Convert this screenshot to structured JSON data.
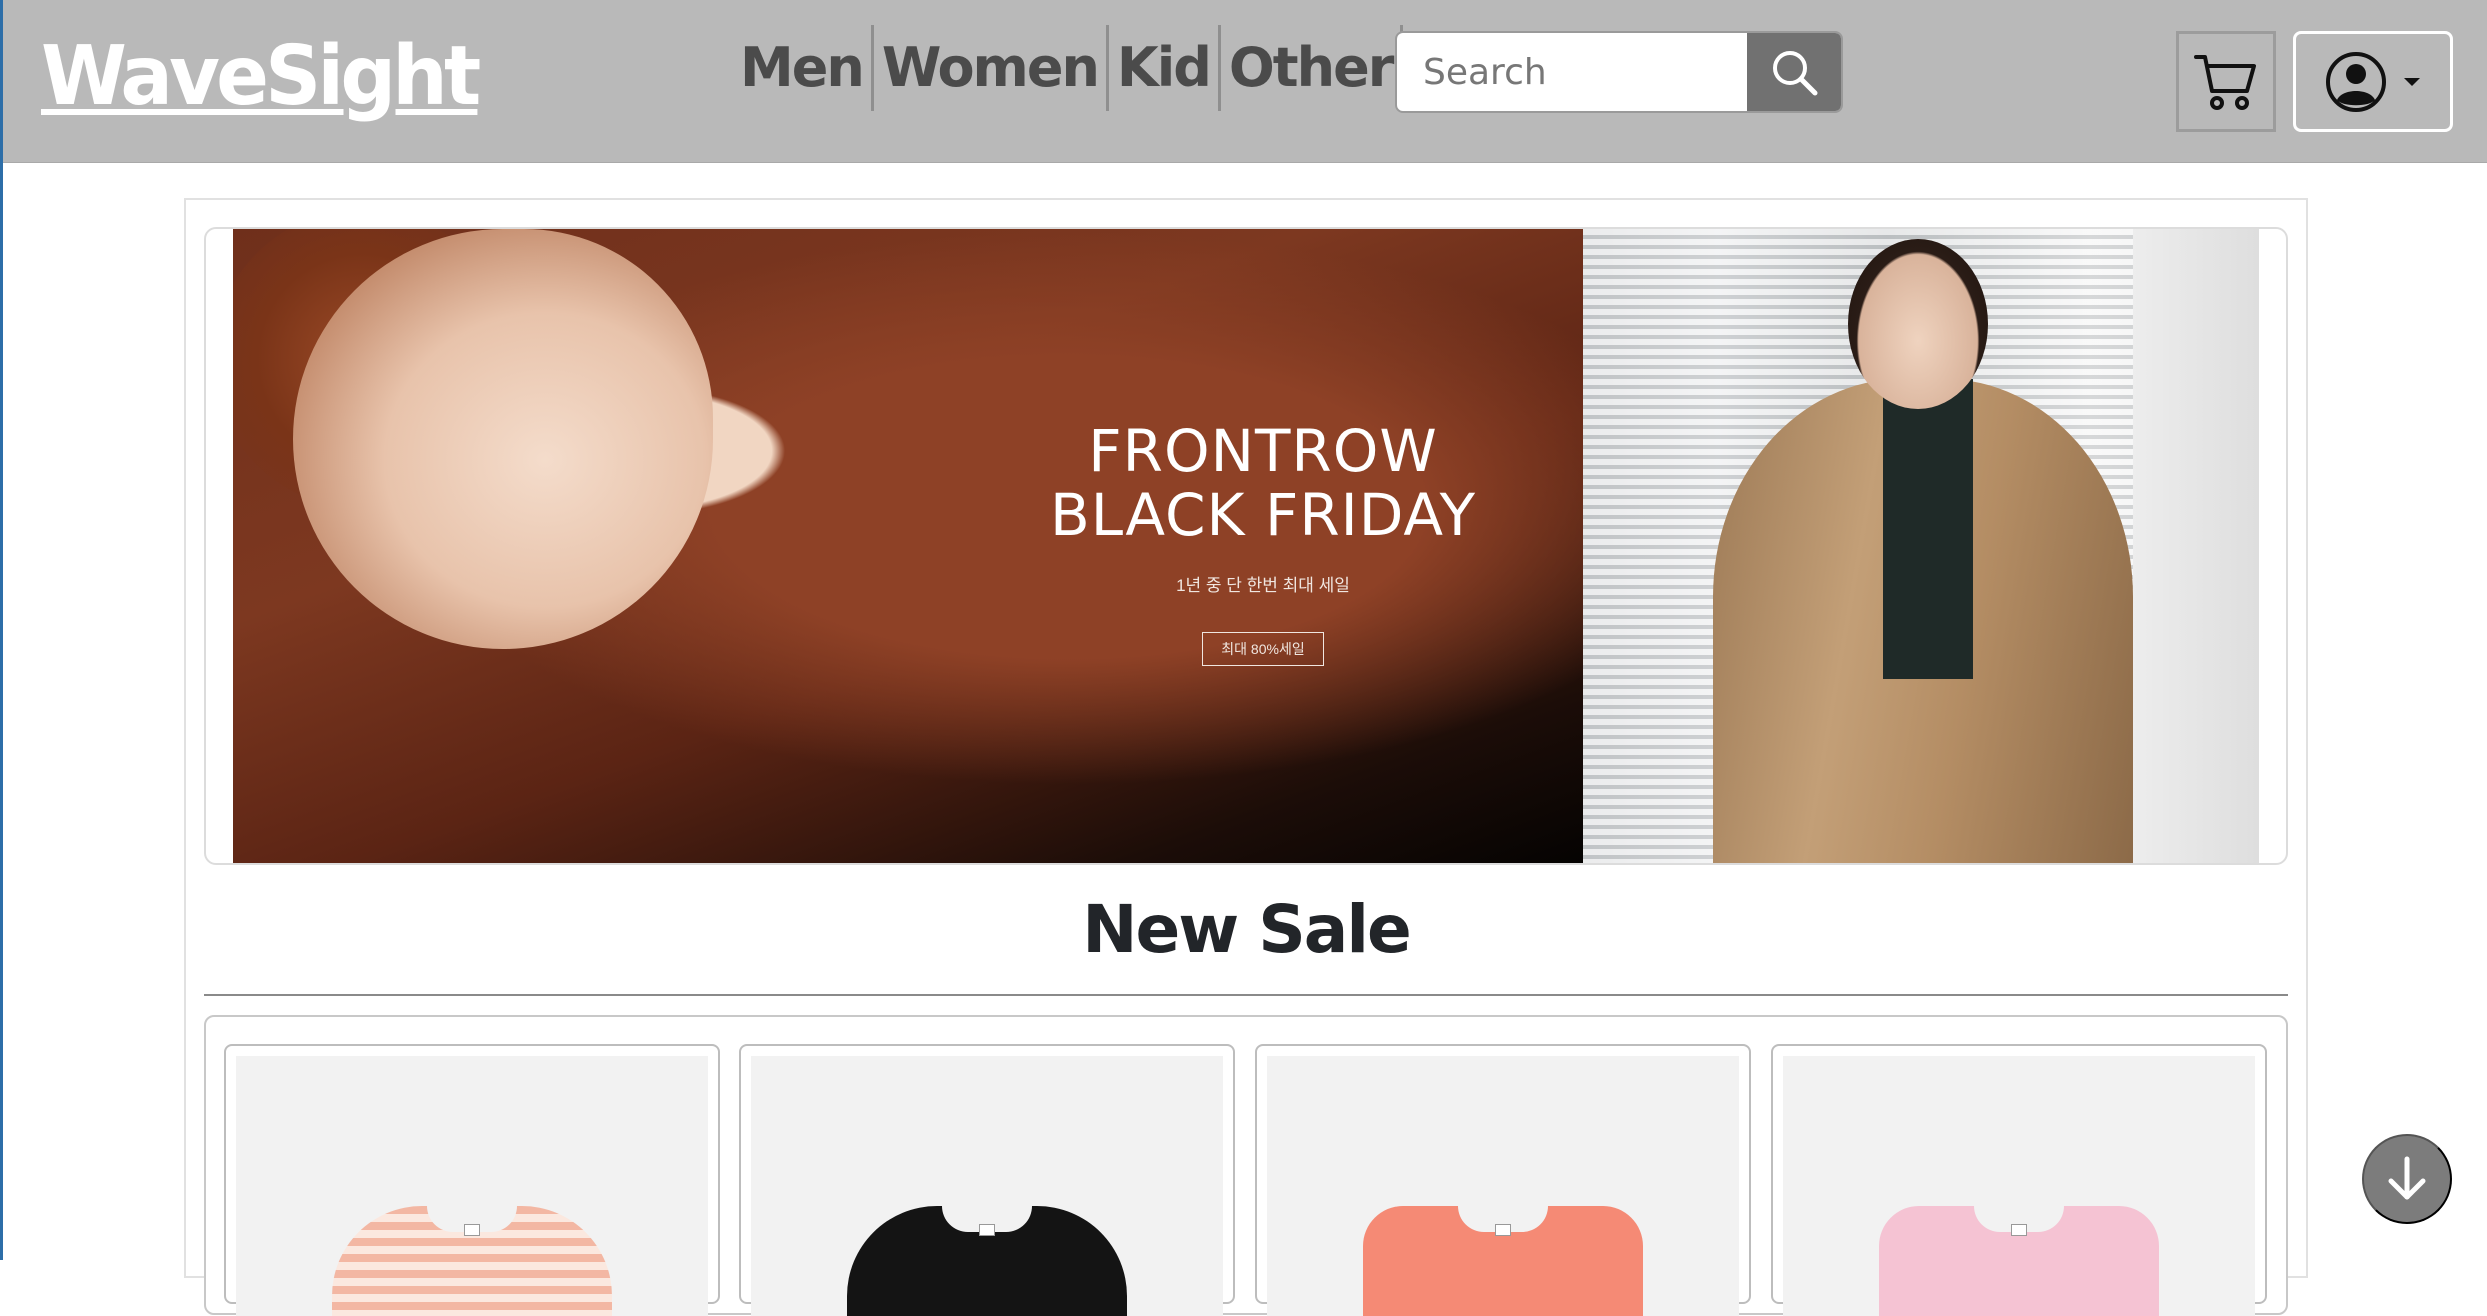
{
  "navbar": {
    "brand": "WaveSight",
    "links": [
      {
        "label": "Men"
      },
      {
        "label": "Women"
      },
      {
        "label": "Kid"
      },
      {
        "label": "Other"
      }
    ],
    "search": {
      "placeholder": "Search",
      "value": ""
    },
    "icons": {
      "search": "search-icon",
      "cart": "cart-icon",
      "user": "user-circle-icon",
      "dropdown": "caret-down-icon"
    }
  },
  "banner": {
    "title_line1": "FRONTROW",
    "title_line2": "BLACK FRIDAY",
    "subtitle": "1년 중 단 한번 최대 세일",
    "button": "최대 80%세일"
  },
  "section": {
    "title": "New Sale"
  },
  "products": [
    {
      "color": "#f3b7a3"
    },
    {
      "color": "#141414"
    },
    {
      "color": "#f58a75"
    },
    {
      "color": "#f5c3d3"
    }
  ],
  "controls": {
    "scroll_down_icon": "arrow-down-icon"
  }
}
